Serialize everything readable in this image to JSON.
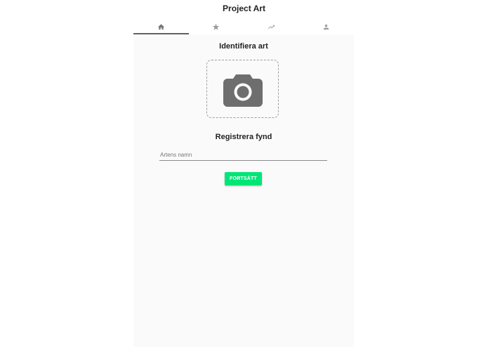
{
  "app": {
    "title": "Project Art"
  },
  "tabs": [
    {
      "icon": "home-icon",
      "active": true
    },
    {
      "icon": "star-icon",
      "active": false
    },
    {
      "icon": "trending-up-icon",
      "active": false
    },
    {
      "icon": "person-icon",
      "active": false
    }
  ],
  "identify": {
    "title": "Identifiera art",
    "icon": "camera-icon"
  },
  "register": {
    "title": "Registrera fynd",
    "name_placeholder": "Artens namn",
    "name_value": "",
    "continue_label": "FORTSÄTT"
  },
  "colors": {
    "accent": "#00e676",
    "icon": "#757575",
    "active_indicator": "#616161",
    "panel_background": "#fafafa"
  }
}
